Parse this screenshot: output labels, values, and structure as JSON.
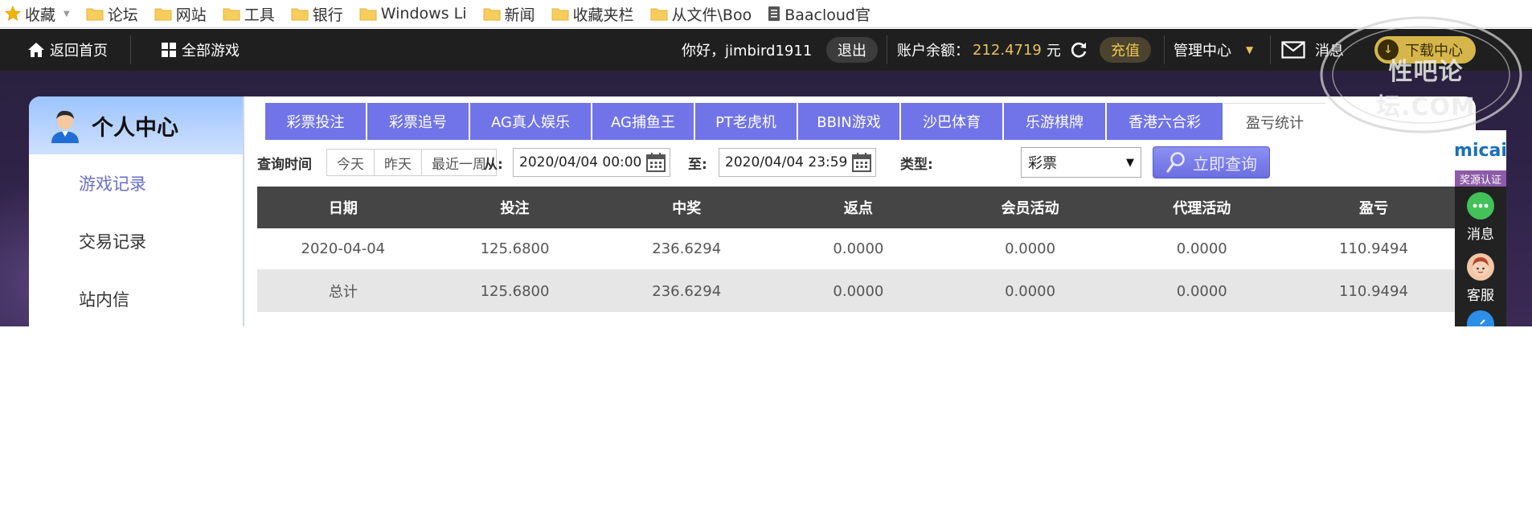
{
  "bookmarks": {
    "items": [
      {
        "label": "收藏",
        "icon": "star-icon"
      },
      {
        "label": "论坛",
        "icon": "folder-icon"
      },
      {
        "label": "网站",
        "icon": "folder-icon"
      },
      {
        "label": "工具",
        "icon": "folder-icon"
      },
      {
        "label": "银行",
        "icon": "folder-icon"
      },
      {
        "label": "Windows Li",
        "icon": "folder-icon"
      },
      {
        "label": "新闻",
        "icon": "folder-icon"
      },
      {
        "label": "收藏夹栏",
        "icon": "folder-icon"
      },
      {
        "label": "从文件\\Boo",
        "icon": "folder-icon"
      },
      {
        "label": "Baacloud官",
        "icon": "document-icon"
      }
    ]
  },
  "topbar": {
    "home_label": "返回首页",
    "all_games_label": "全部游戏",
    "greeting": "你好，jimbird1911",
    "logout_label": "退出",
    "balance_label": "账户余额：",
    "balance_value": "212.4719",
    "balance_unit": "元",
    "recharge_label": "充值",
    "manage_label": "管理中心",
    "messages_label": "消息",
    "download_label": "下载中心"
  },
  "sidebar": {
    "title": "个人中心",
    "items": [
      {
        "label": "游戏记录",
        "active": true
      },
      {
        "label": "交易记录",
        "active": false
      },
      {
        "label": "站内信",
        "active": false
      }
    ]
  },
  "tabs": [
    {
      "label": "彩票投注",
      "active": false
    },
    {
      "label": "彩票追号",
      "active": false
    },
    {
      "label": "AG真人娱乐",
      "active": false
    },
    {
      "label": "AG捕鱼王",
      "active": false
    },
    {
      "label": "PT老虎机",
      "active": false
    },
    {
      "label": "BBIN游戏",
      "active": false
    },
    {
      "label": "沙巴体育",
      "active": false
    },
    {
      "label": "乐游棋牌",
      "active": false
    },
    {
      "label": "香港六合彩",
      "active": false
    },
    {
      "label": "盈亏统计",
      "active": true
    }
  ],
  "query": {
    "time_label": "查询时间",
    "quick_buttons": [
      "今天",
      "昨天",
      "最近一周"
    ],
    "from_label": "从:",
    "from_value": "2020/04/04 00:00",
    "to_label": "至:",
    "to_value": "2020/04/04 23:59",
    "type_label": "类型:",
    "type_value": "彩票",
    "search_label": "立即查询"
  },
  "table": {
    "headers": [
      "日期",
      "投注",
      "中奖",
      "返点",
      "会员活动",
      "代理活动",
      "盈亏"
    ],
    "rows": [
      [
        "2020-04-04",
        "125.6800",
        "236.6294",
        "0.0000",
        "0.0000",
        "0.0000",
        "110.9494"
      ],
      [
        "总计",
        "125.6800",
        "236.6294",
        "0.0000",
        "0.0000",
        "0.0000",
        "110.9494"
      ]
    ]
  },
  "right_bar": {
    "logo_text": "micai",
    "cert_label": "奖源认证",
    "items": [
      {
        "label": "消息",
        "icon": "chat-icon"
      },
      {
        "label": "客服",
        "icon": "support-agent-icon"
      }
    ]
  },
  "watermark": {
    "text": "性吧论坛.COM"
  },
  "colors": {
    "tab_bg": "#7174e8",
    "topbar_bg": "#1f1f1f",
    "accent_gold": "#e9c15a",
    "table_head_bg": "#454545",
    "sidebar_active": "#6b6fc9"
  }
}
